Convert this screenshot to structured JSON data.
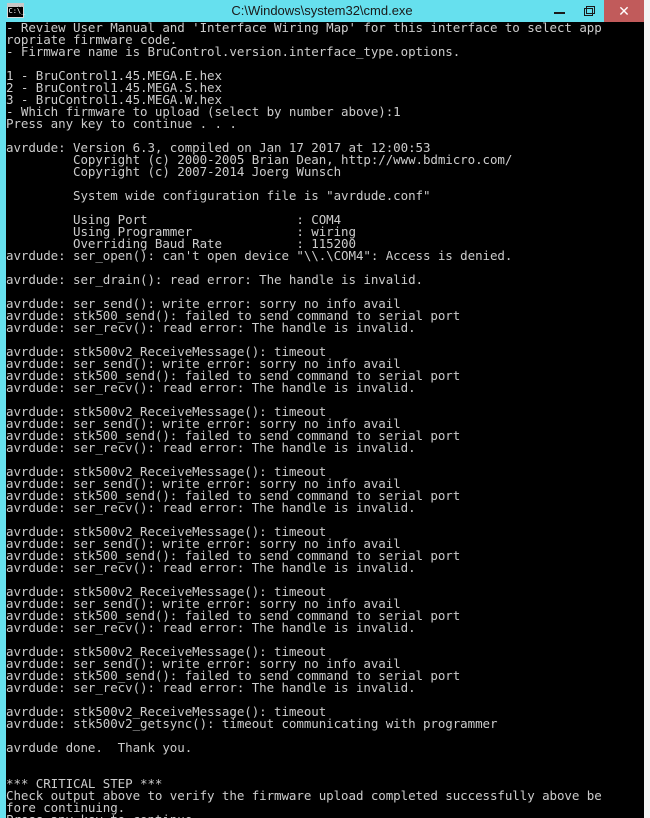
{
  "window": {
    "title": "C:\\Windows\\system32\\cmd.exe",
    "icon": "cmd-console-icon",
    "icon_prompt_text": "C:\\_",
    "titlebar_color": "#66E0EE",
    "close_button_color": "#C15B5B",
    "console_bg": "#000000",
    "console_fg": "#CCCCCC",
    "buttons": {
      "minimize_label": "minimize",
      "maximize_label": "restore",
      "close_label": "✕"
    }
  },
  "console": {
    "lines": [
      "- Review User Manual and 'Interface Wiring Map' for this interface to select app",
      "ropriate firmware code.",
      "- Firmware name is BruControl.version.interface_type.options.",
      "",
      "1 - BruControl1.45.MEGA.E.hex",
      "2 - BruControl1.45.MEGA.S.hex",
      "3 - BruControl1.45.MEGA.W.hex",
      "- Which firmware to upload (select by number above):1",
      "Press any key to continue . . .",
      "",
      "avrdude: Version 6.3, compiled on Jan 17 2017 at 12:00:53",
      "         Copyright (c) 2000-2005 Brian Dean, http://www.bdmicro.com/",
      "         Copyright (c) 2007-2014 Joerg Wunsch",
      "",
      "         System wide configuration file is \"avrdude.conf\"",
      "",
      "         Using Port                    : COM4",
      "         Using Programmer              : wiring",
      "         Overriding Baud Rate          : 115200",
      "avrdude: ser_open(): can't open device \"\\\\.\\COM4\": Access is denied.",
      "",
      "avrdude: ser_drain(): read error: The handle is invalid.",
      "",
      "avrdude: ser_send(): write error: sorry no info avail",
      "avrdude: stk500_send(): failed to send command to serial port",
      "avrdude: ser_recv(): read error: The handle is invalid.",
      "",
      "avrdude: stk500v2_ReceiveMessage(): timeout",
      "avrdude: ser_send(): write error: sorry no info avail",
      "avrdude: stk500_send(): failed to send command to serial port",
      "avrdude: ser_recv(): read error: The handle is invalid.",
      "",
      "avrdude: stk500v2_ReceiveMessage(): timeout",
      "avrdude: ser_send(): write error: sorry no info avail",
      "avrdude: stk500_send(): failed to send command to serial port",
      "avrdude: ser_recv(): read error: The handle is invalid.",
      "",
      "avrdude: stk500v2_ReceiveMessage(): timeout",
      "avrdude: ser_send(): write error: sorry no info avail",
      "avrdude: stk500_send(): failed to send command to serial port",
      "avrdude: ser_recv(): read error: The handle is invalid.",
      "",
      "avrdude: stk500v2_ReceiveMessage(): timeout",
      "avrdude: ser_send(): write error: sorry no info avail",
      "avrdude: stk500_send(): failed to send command to serial port",
      "avrdude: ser_recv(): read error: The handle is invalid.",
      "",
      "avrdude: stk500v2_ReceiveMessage(): timeout",
      "avrdude: ser_send(): write error: sorry no info avail",
      "avrdude: stk500_send(): failed to send command to serial port",
      "avrdude: ser_recv(): read error: The handle is invalid.",
      "",
      "avrdude: stk500v2_ReceiveMessage(): timeout",
      "avrdude: ser_send(): write error: sorry no info avail",
      "avrdude: stk500_send(): failed to send command to serial port",
      "avrdude: ser_recv(): read error: The handle is invalid.",
      "",
      "avrdude: stk500v2_ReceiveMessage(): timeout",
      "avrdude: stk500v2_getsync(): timeout communicating with programmer",
      "",
      "avrdude done.  Thank you.",
      "",
      "",
      "*** CRITICAL STEP ***",
      "Check output above to verify the firmware upload completed successfully above be",
      "fore continuing.",
      "Press any key to continue . . ."
    ],
    "cursor_visible": true,
    "cursor_style": "underscore-block"
  }
}
